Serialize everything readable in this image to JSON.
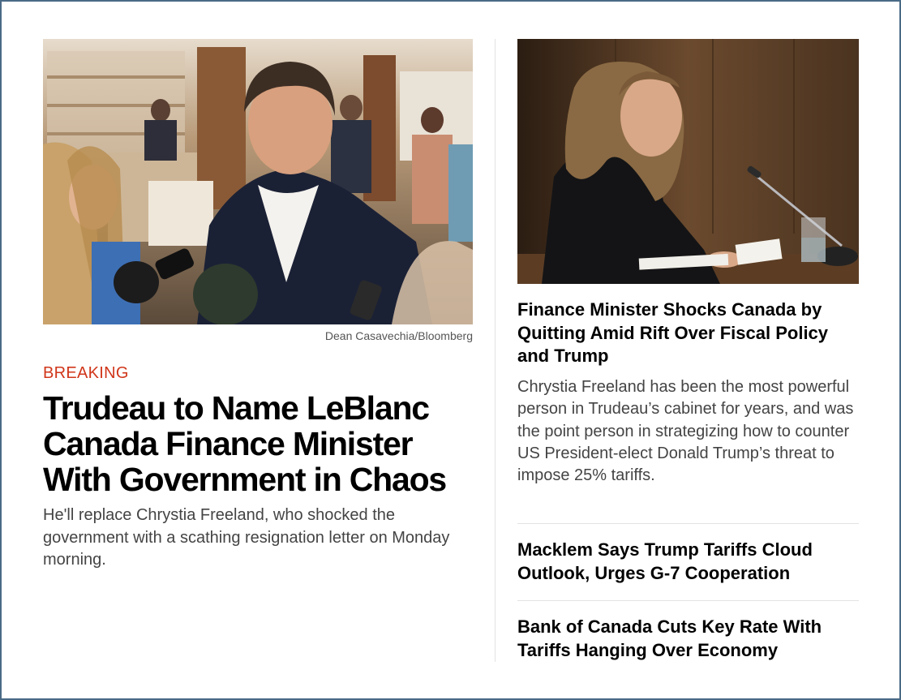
{
  "lead": {
    "photo_credit": "Dean Casavechia/Bloomberg",
    "label": "BREAKING",
    "headline": "Trudeau to Name LeBlanc Canada Finance Minister With Government in Chaos",
    "dek": "He'll replace Chrystia Freeland, who shocked the government with a scathing resignation letter on Monday morning."
  },
  "side": {
    "headline": "Finance Minister Shocks Canada by Quitting Amid Rift Over Fiscal Policy and Trump",
    "dek": "Chrystia Freeland has been the most powerful person in Trudeau’s cabinet for years, and was the point person in strategizing how to counter US President-elect Donald Trump’s threat to impose 25% tariffs."
  },
  "more_stories": [
    {
      "headline": "Macklem Says Trump Tariffs Cloud Outlook, Urges G-7 Cooperation"
    },
    {
      "headline": "Bank of Canada Cuts Key Rate With Tariffs Hanging Over Economy"
    }
  ],
  "colors": {
    "breaking": "#d0361a",
    "frame_border": "#4a6a86",
    "divider": "#e3e3e3"
  }
}
